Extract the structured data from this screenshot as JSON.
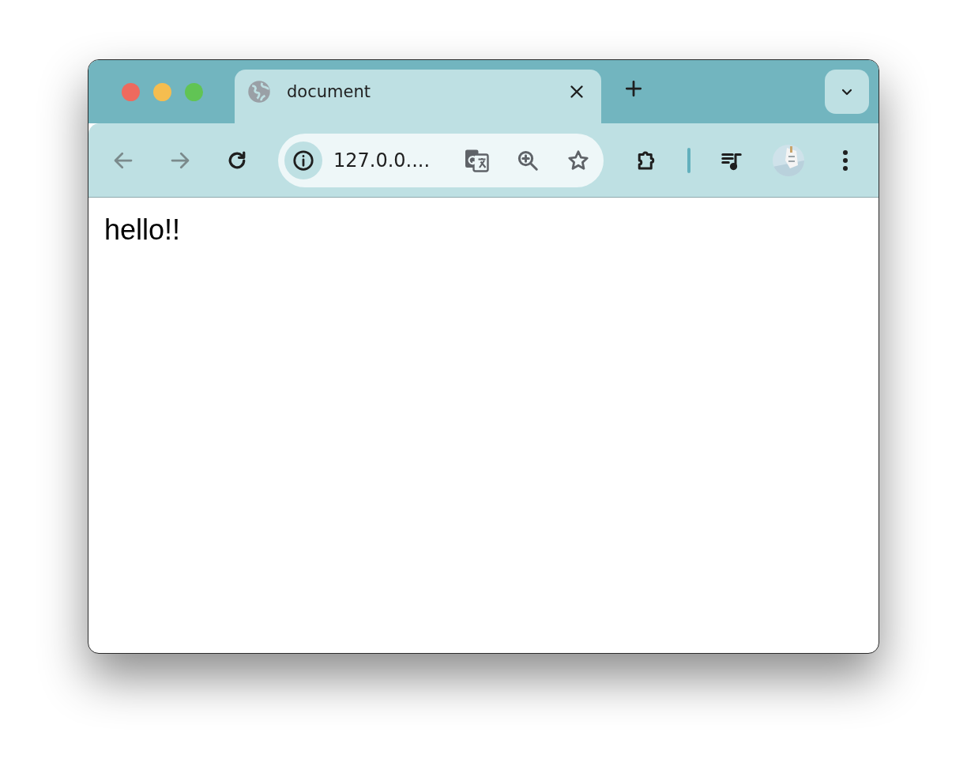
{
  "tabs": [
    {
      "title": "document",
      "selected": true
    }
  ],
  "address_bar": {
    "value": "127.0.0...."
  },
  "page": {
    "text": "hello!!"
  }
}
